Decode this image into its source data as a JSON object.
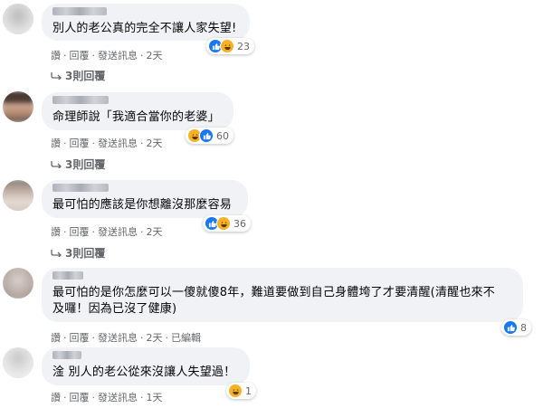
{
  "comments": [
    {
      "text": "別人的老公真的完全不讓人家失望!",
      "actions": [
        "讚",
        "回覆",
        "發送訊息",
        "2天"
      ],
      "reactions": [
        "like-icon",
        "haha-icon"
      ],
      "reaction_count": "23",
      "replies": "3則回覆"
    },
    {
      "text": "命理師說「我適合當你的老婆」",
      "actions": [
        "讚",
        "回覆",
        "發送訊息",
        "2天"
      ],
      "reactions": [
        "haha-icon",
        "like-icon"
      ],
      "reaction_count": "60",
      "replies": "3則回覆"
    },
    {
      "text": "最可怕的應該是你想離沒那麼容易",
      "actions": [
        "讚",
        "回覆",
        "發送訊息",
        "2天"
      ],
      "reactions": [
        "like-icon",
        "haha-icon"
      ],
      "reaction_count": "36",
      "replies": "3則回覆"
    },
    {
      "text": "最可怕的是你怎麼可以一傻就傻8年，難道要做到自己身體垮了才要清醒(清醒也來不\n及囉！因為已沒了健康)",
      "actions": [
        "讚",
        "回覆",
        "發送訊息",
        "2天",
        "已編輯"
      ],
      "reactions": [
        "like-icon"
      ],
      "reaction_count": "8"
    },
    {
      "text": "淦 別人的老公從來沒讓人失望過！",
      "actions": [
        "讚",
        "回覆",
        "發送訊息",
        "1天"
      ],
      "reactions": [
        "haha-icon"
      ],
      "reaction_count": "1"
    }
  ],
  "colors": {
    "bubble": "#f0f2f5",
    "meta": "#65676b",
    "like": "#1877f2",
    "haha": "#f7b125"
  }
}
